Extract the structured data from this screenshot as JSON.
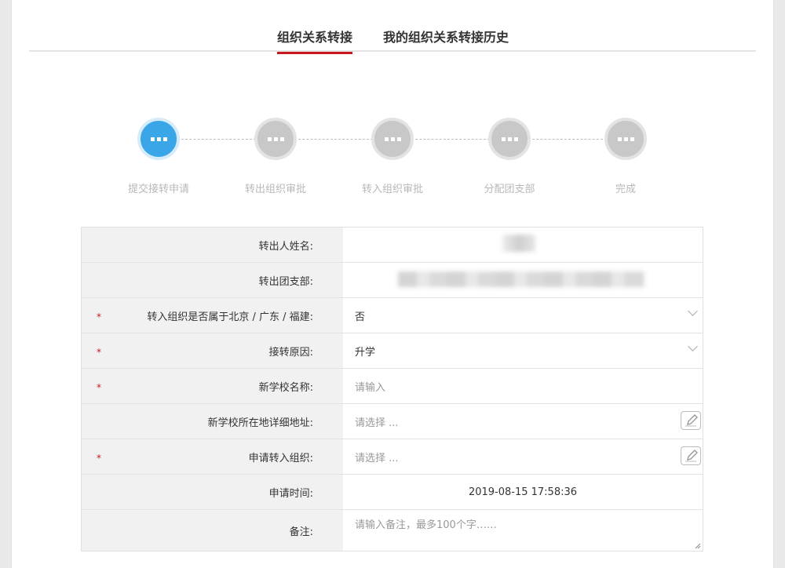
{
  "tabs": [
    {
      "label": "组织关系转接",
      "active": true
    },
    {
      "label": "我的组织关系转接历史",
      "active": false
    }
  ],
  "steps": [
    {
      "label": "提交接转申请",
      "active": true
    },
    {
      "label": "转出组织审批",
      "active": false
    },
    {
      "label": "转入组织审批",
      "active": false
    },
    {
      "label": "分配团支部",
      "active": false
    },
    {
      "label": "完成",
      "active": false
    }
  ],
  "form": {
    "out_name": {
      "label": "转出人姓名:"
    },
    "out_branch": {
      "label": "转出团支部:"
    },
    "in_region": {
      "label": "转入组织是否属于北京 / 广东 / 福建:",
      "value": "否",
      "required": "*"
    },
    "reason": {
      "label": "接转原因:",
      "value": "升学",
      "required": "*"
    },
    "school_name": {
      "label": "新学校名称:",
      "placeholder": "请输入",
      "required": "*"
    },
    "school_address": {
      "label": "新学校所在地详细地址:",
      "placeholder": "请选择 ..."
    },
    "target_org": {
      "label": "申请转入组织:",
      "placeholder": "请选择 ...",
      "required": "*"
    },
    "apply_time": {
      "label": "申请时间:",
      "value": "2019-08-15 17:58:36"
    },
    "remark": {
      "label": "备注:",
      "placeholder": "请输入备注，最多100个字……"
    }
  },
  "colors": {
    "accent": "#c9171e",
    "step_active": "#3aa6e8",
    "step_inactive": "#c8c8c8"
  },
  "icons": {
    "edit": "edit-pencil-icon",
    "dropdown": "chevron-down-icon",
    "step": "dots-icon"
  }
}
